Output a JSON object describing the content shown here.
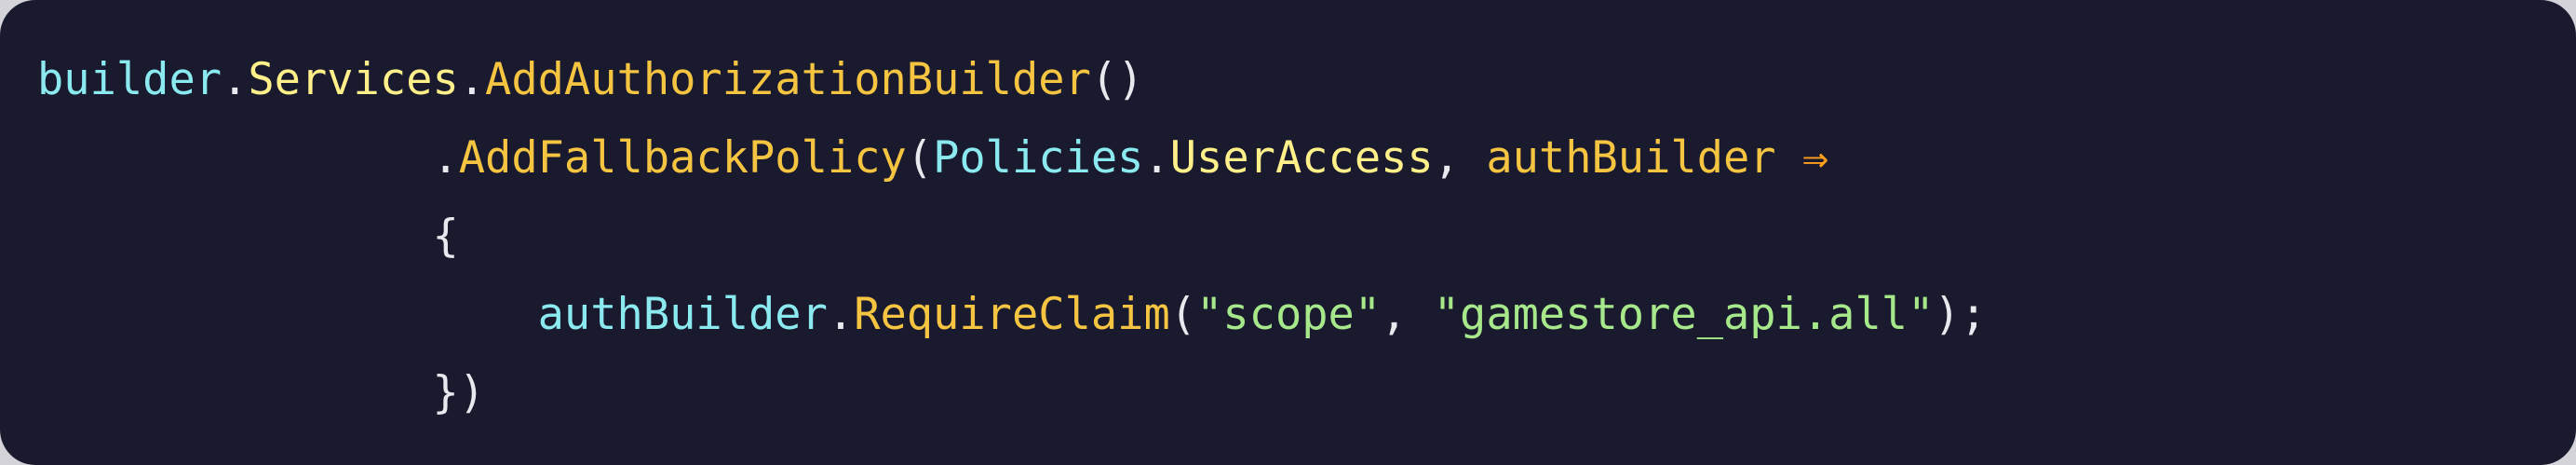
{
  "colors": {
    "background": "#1a1a2e",
    "variable": "#8be9f0",
    "type": "#fff08a",
    "method": "#f5c542",
    "arrow": "#ff9f1c",
    "string": "#a6e88a",
    "punctuation": "#e8e8ef"
  },
  "code": {
    "line1": {
      "builder": "builder",
      "dot1": ".",
      "services": "Services",
      "dot2": ".",
      "method": "AddAuthorizationBuilder",
      "parens": "()"
    },
    "line2": {
      "indent": "               ",
      "dot1": ".",
      "method": "AddFallbackPolicy",
      "open_paren": "(",
      "policies": "Policies",
      "dot2": ".",
      "user_access": "UserAccess",
      "comma": ", ",
      "param": "authBuilder",
      "space": " ",
      "arrow": "⇒"
    },
    "line3": {
      "indent": "               ",
      "brace": "{"
    },
    "line4": {
      "indent": "                   ",
      "auth_builder": "authBuilder",
      "dot": ".",
      "method": "RequireClaim",
      "open_paren": "(",
      "arg1": "\"scope\"",
      "comma": ", ",
      "arg2": "\"gamestore_api.all\"",
      "close": ");"
    },
    "line5": {
      "indent": "               ",
      "close": "})"
    }
  }
}
